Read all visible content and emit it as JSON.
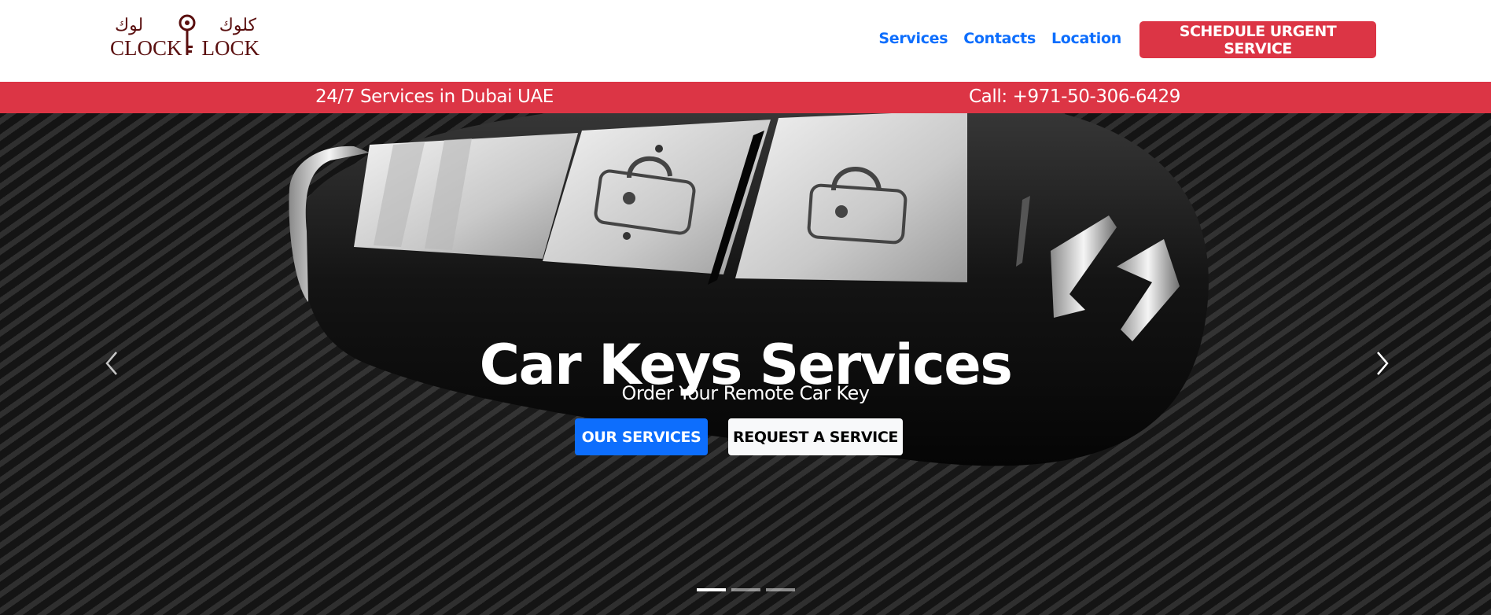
{
  "brand": {
    "arabic_left": "كلوك",
    "arabic_right": "لوك",
    "latin_left": "CLOCK",
    "latin_right": "LOCK",
    "logo_color": "#5a0f0f"
  },
  "nav": {
    "links": [
      "Services",
      "Contacts",
      "Location"
    ],
    "urgent_button": "SCHEDULE URGENT SERVICE"
  },
  "info_bar": {
    "left_text": "24/7 Services in Dubai UAE",
    "right_text": "Call: +971-50-306-6429",
    "color": "#dc3545"
  },
  "hero": {
    "title": "Car Keys Services",
    "subtitle": "Order Your Remote Car Key",
    "primary_button": "OUR SERVICES",
    "secondary_button": "REQUEST A SERVICE",
    "prev_icon": "chevron-left-icon",
    "next_icon": "chevron-right-icon",
    "slide_count": 3,
    "active_slide": 1
  },
  "colors": {
    "accent_blue": "#0d6efd",
    "accent_red": "#dc3545"
  }
}
